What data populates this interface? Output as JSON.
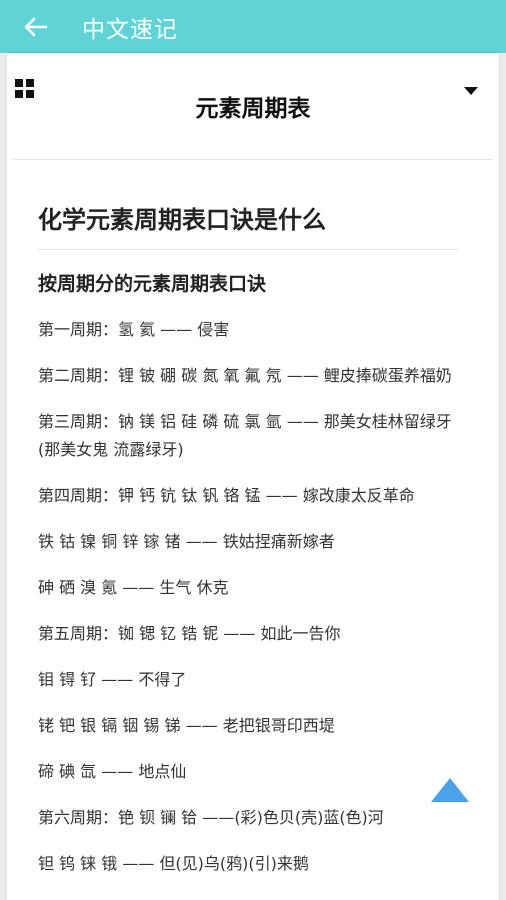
{
  "appbar": {
    "title": "中文速记",
    "back_icon": "arrow-left-icon"
  },
  "header": {
    "title": "元素周期表",
    "menu_icon": "grid-icon",
    "dropdown_icon": "triangle-down-icon"
  },
  "article": {
    "title": "化学元素周期表口诀是什么",
    "section_title": "按周期分的元素周期表口诀",
    "lines": [
      "第一周期：氢 氦 —— 侵害",
      "第二周期：锂 铍 硼 碳 氮 氧 氟 氖 —— 鲤皮捧碳蛋养福奶",
      "第三周期：钠 镁 铝 硅 磷 硫 氯 氩 —— 那美女桂林留绿牙(那美女鬼 流露绿牙)",
      "第四周期：钾 钙 钪 钛 钒 铬 锰 —— 嫁改康太反革命",
      "铁 钴 镍 铜 锌 镓 锗 —— 铁姑捏痛新嫁者",
      "砷 硒 溴 氪 —— 生气 休克",
      "第五周期：铷 锶 钇 锆 铌 —— 如此一告你",
      "钼 锝 钌 —— 不得了",
      "铑 钯 银 镉 铟 锡 锑 —— 老把银哥印西堤",
      "碲 碘 氙 —— 地点仙",
      "第六周期：铯 钡 镧 铪 ——(彩)色贝(壳)蓝(色)河",
      "钽 钨 铼 锇 —— 但(见)乌(鸦)(引)来鹅"
    ]
  },
  "colors": {
    "appbar": "#5fd3d6",
    "scroll_top": "#4aa3e8"
  },
  "scroll_top_icon": "triangle-up-icon"
}
